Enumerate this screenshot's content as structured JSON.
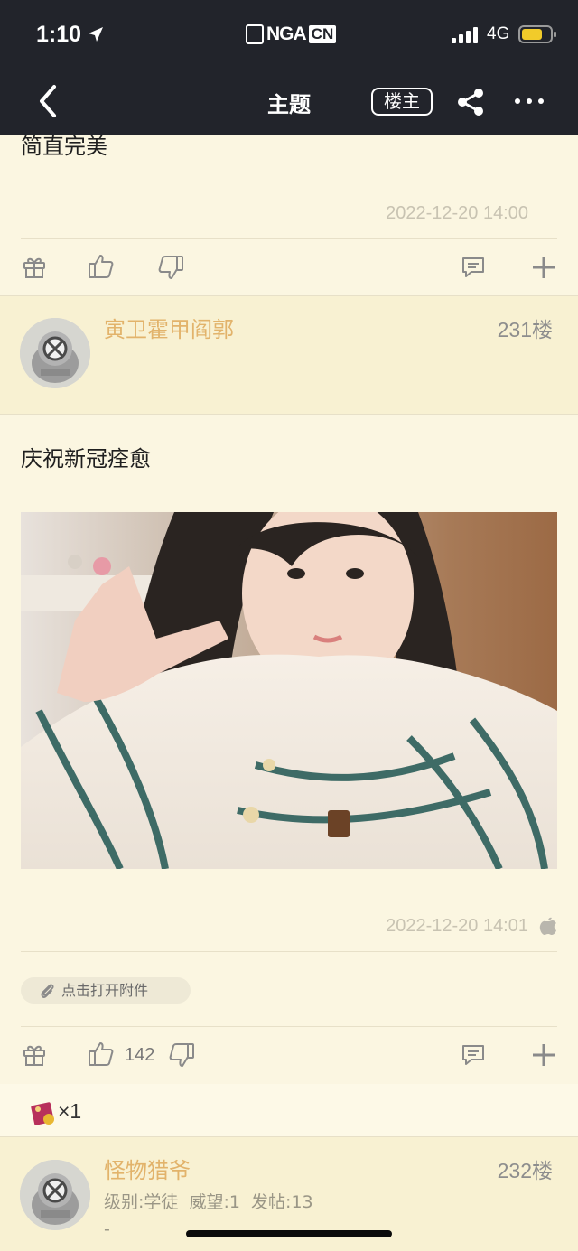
{
  "status_bar": {
    "time": "1:10",
    "network": "4G",
    "logo_left": "NGA",
    "logo_right": "CN"
  },
  "nav": {
    "title": "主题",
    "op_label": "楼主"
  },
  "post_prev": {
    "text": "简直完美",
    "timestamp": "2022-12-20 14:00"
  },
  "post_231": {
    "username": "寅卫霍甲阎郭",
    "floor": "231楼",
    "text": "庆祝新冠痊愈",
    "timestamp": "2022-12-20 14:01",
    "attachment_label": "点击打开附件",
    "like_count": "142",
    "reward_count": "×1"
  },
  "post_232": {
    "username": "怪物猎爷",
    "floor": "232楼",
    "meta": "级别:学徒  威望:1  发帖:13",
    "signature": "-"
  },
  "colors": {
    "background": "#fbf6e1",
    "topbar": "#22242b",
    "username": "#e2b36b"
  },
  "icons": [
    "location-arrow-icon",
    "signal-icon",
    "battery-icon",
    "back-icon",
    "share-icon",
    "more-icon",
    "gift-icon",
    "thumbs-up-icon",
    "thumbs-down-icon",
    "comment-icon",
    "plus-icon",
    "apple-icon",
    "paperclip-icon",
    "reward-icon"
  ]
}
